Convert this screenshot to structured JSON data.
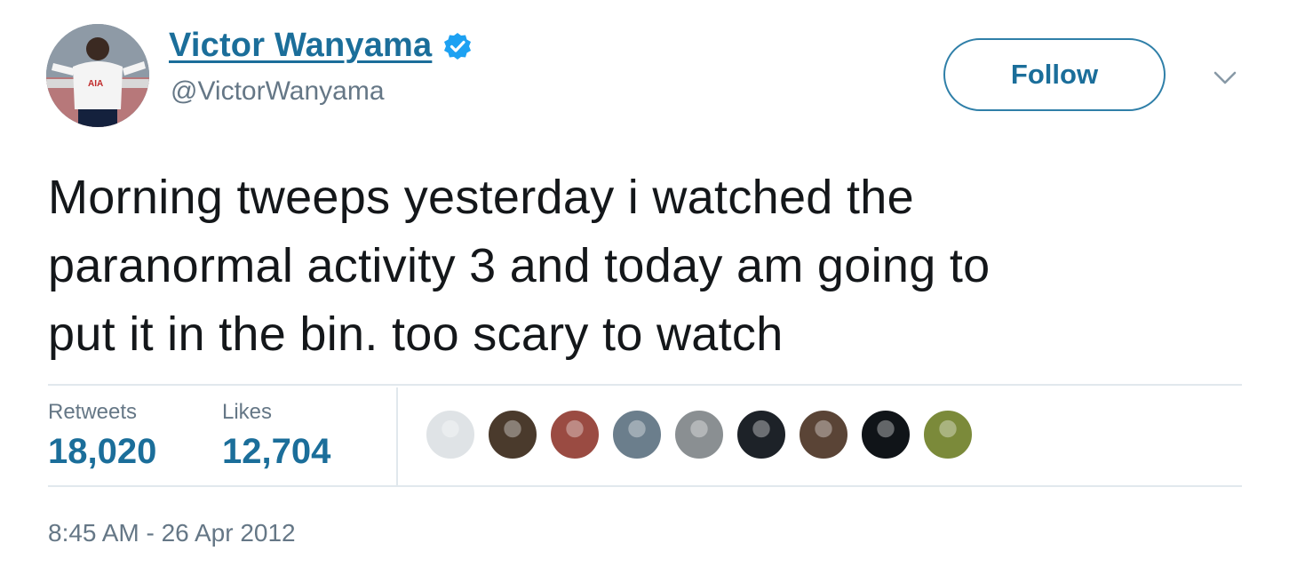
{
  "user": {
    "name": "Victor Wanyama",
    "handle": "@VictorWanyama",
    "verified_color": "#1da1f2",
    "jersey_text": "AIA"
  },
  "actions": {
    "follow_label": "Follow",
    "menu_icon": "chevron-down-icon"
  },
  "tweet": {
    "lines": [
      "Morning tweeps yesterday i watched the",
      "paranormal activity 3 and today am going to",
      "put it in the bin. too scary to watch"
    ]
  },
  "stats": {
    "retweets_label": "Retweets",
    "retweets_value": "18,020",
    "likes_label": "Likes",
    "likes_value": "12,704"
  },
  "likers": [
    {
      "color": "#dfe3e6"
    },
    {
      "color": "#4a3a2c"
    },
    {
      "color": "#9a4b42"
    },
    {
      "color": "#6b7e8c"
    },
    {
      "color": "#8a8f92"
    },
    {
      "color": "#1d2228"
    },
    {
      "color": "#5a4436"
    },
    {
      "color": "#101418"
    },
    {
      "color": "#7b8a3a"
    }
  ],
  "timestamp": "8:45 AM - 26 Apr 2012",
  "colors": {
    "link": "#1b6e9a",
    "muted": "#657786",
    "divider": "#e1e8ed"
  }
}
